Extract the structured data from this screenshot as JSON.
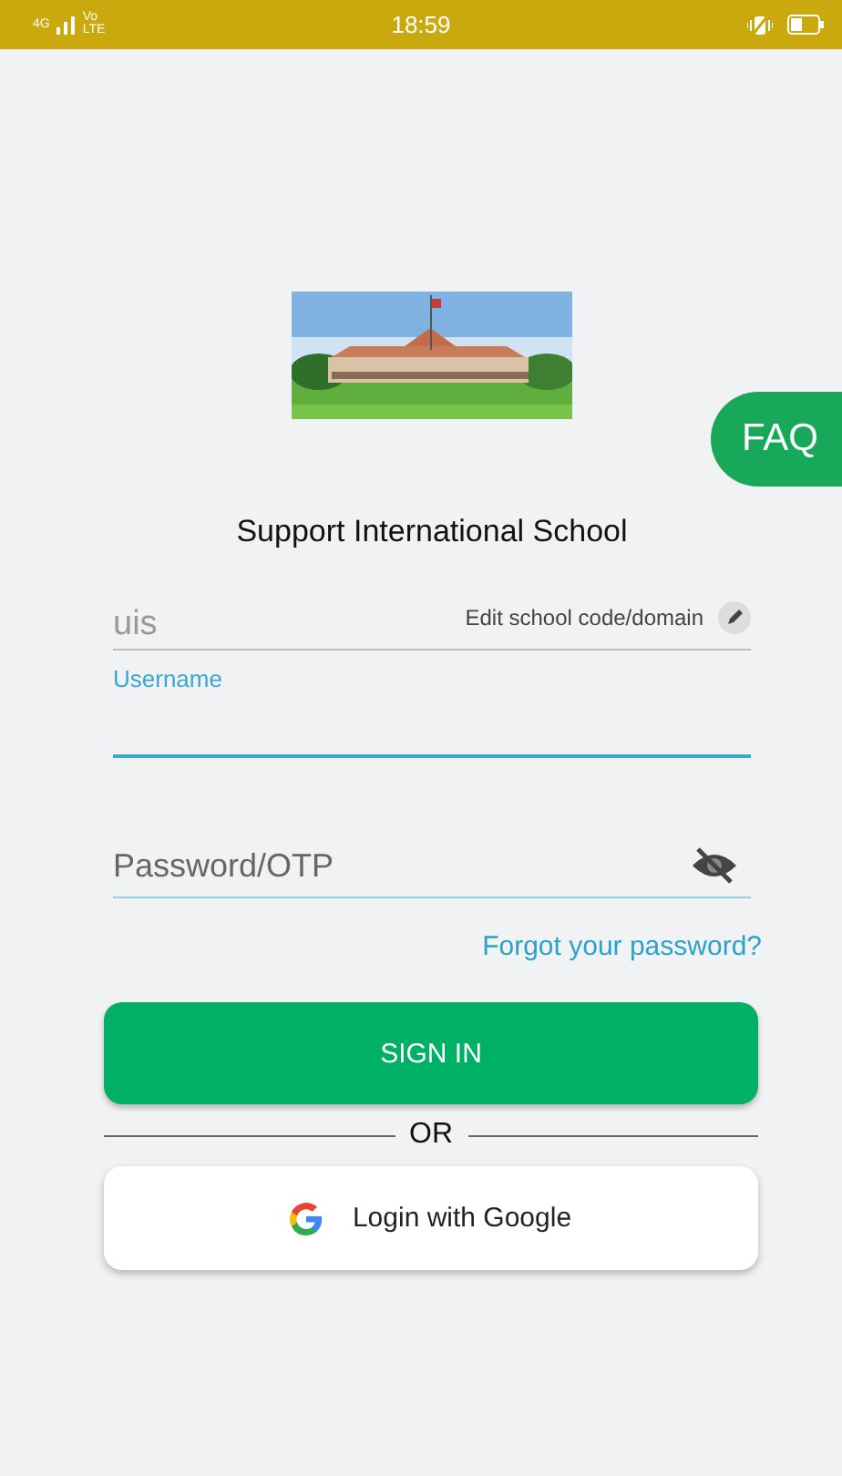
{
  "status_bar": {
    "network": "4G",
    "volte": "Vo LTE",
    "time": "18:59"
  },
  "faq_button": "FAQ",
  "school_name": "Support International School",
  "school_code": {
    "value": "uis",
    "edit_label": "Edit school code/domain"
  },
  "username": {
    "label": "Username",
    "focused": true
  },
  "password": {
    "placeholder": "Password/OTP",
    "visible": false
  },
  "forgot_link": "Forgot your password?",
  "sign_in_button": "SIGN IN",
  "divider_text": "OR",
  "google_button": "Login with Google"
}
